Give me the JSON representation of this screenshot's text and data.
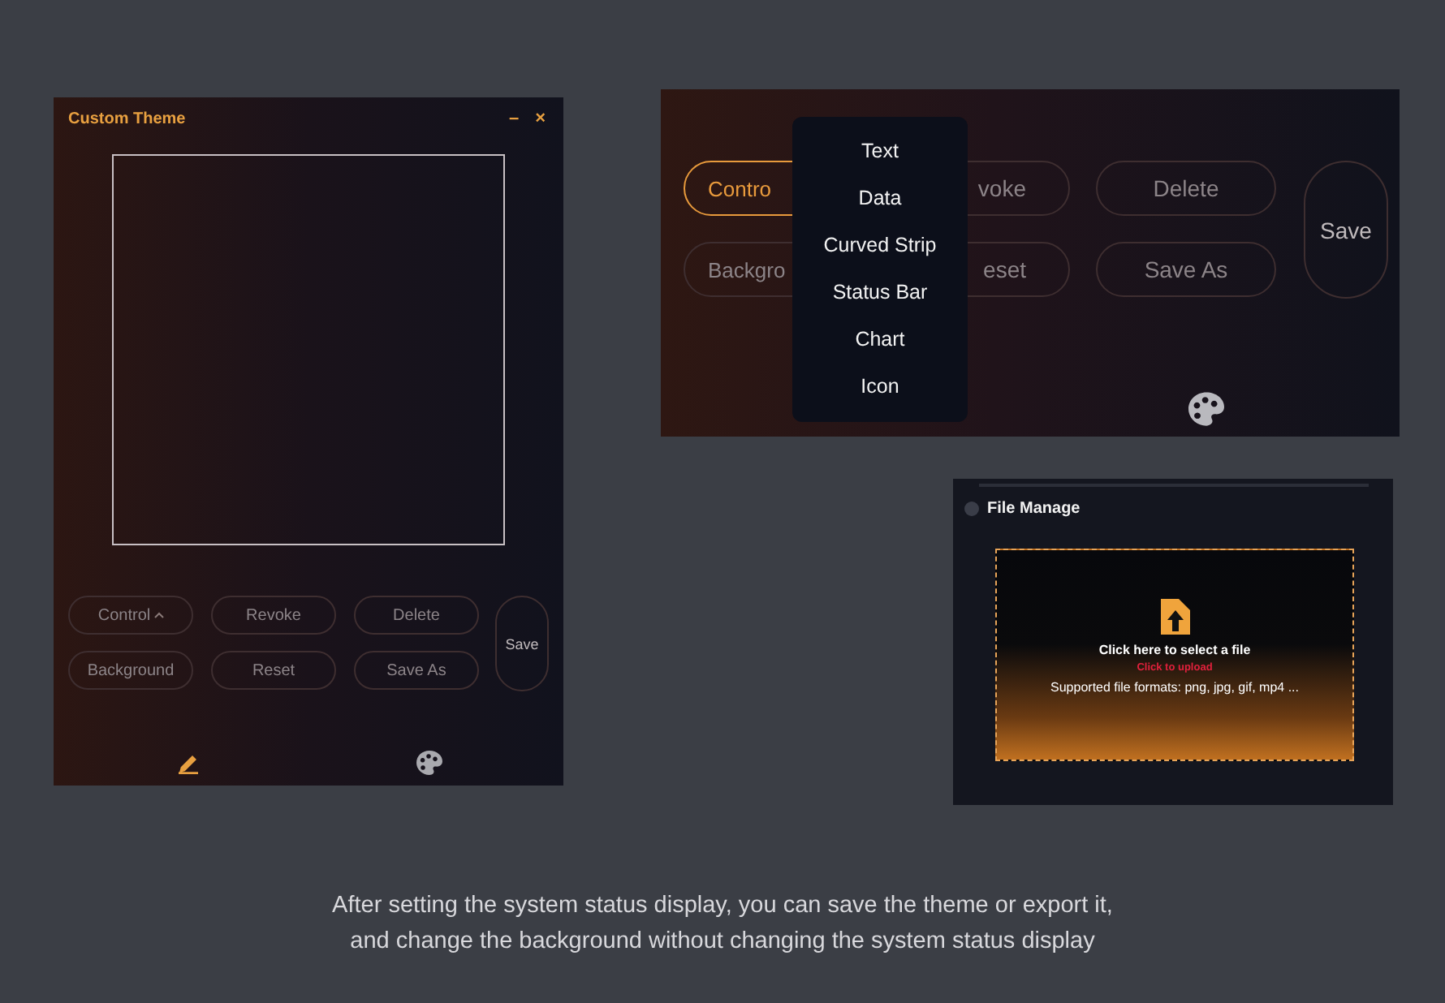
{
  "custom_theme_window": {
    "title": "Custom Theme",
    "window_buttons": [
      "–",
      "×"
    ],
    "buttons": [
      {
        "label": "Control",
        "kind": "dropdown",
        "selected": false
      },
      {
        "label": "Revoke",
        "kind": "plain",
        "selected": false
      },
      {
        "label": "Delete",
        "kind": "plain",
        "selected": false
      },
      {
        "label": "Background",
        "kind": "plain",
        "selected": false
      },
      {
        "label": "Reset",
        "kind": "plain",
        "selected": false
      },
      {
        "label": "Save As",
        "kind": "plain",
        "selected": false
      }
    ],
    "save_button": "Save",
    "bottom_tabs": [
      {
        "kind": "pencil",
        "selected": true
      },
      {
        "kind": "palette",
        "selected": false
      }
    ]
  },
  "control_menu_view": {
    "buttons": [
      {
        "label": "Contro",
        "kind": "cut_right",
        "selected": true
      },
      {
        "label": "voke",
        "kind": "cut_left",
        "selected": false
      },
      {
        "label": "Delete",
        "kind": "plain",
        "selected": false
      },
      {
        "label": "Backgro",
        "kind": "cut_right",
        "selected": false
      },
      {
        "label": "eset",
        "kind": "cut_left",
        "selected": false
      },
      {
        "label": "Save As",
        "kind": "plain",
        "selected": false
      }
    ],
    "save_button": "Save",
    "menu": [
      "Text",
      "Data",
      "Curved Strip",
      "Status Bar",
      "Chart",
      "Icon"
    ]
  },
  "file_manage": {
    "title": "File Manage",
    "select_text": "Click here to select a file",
    "upload_link": "Click to upload",
    "formats": "Supported file formats: png, jpg, gif, mp4 ..."
  },
  "caption": [
    "After setting the system status display, you can save the theme or export it,",
    "and change the background without changing the system status display"
  ]
}
